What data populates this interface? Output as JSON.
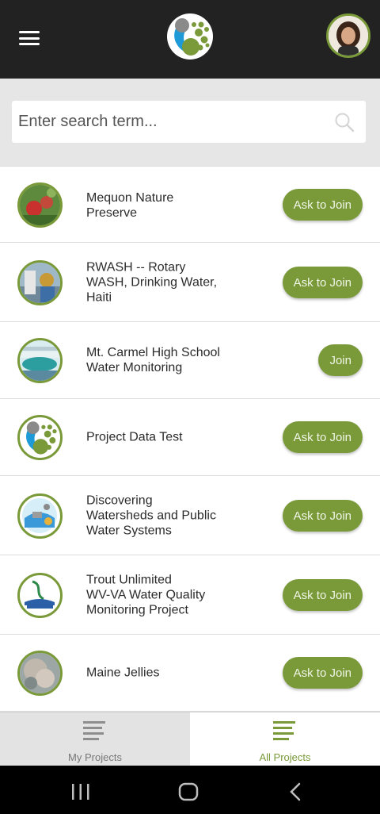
{
  "header": {
    "menu_icon": "hamburger-menu-icon",
    "logo_icon": "app-logo-icon",
    "avatar_icon": "user-avatar",
    "colors": {
      "bar": "#222222",
      "accent": "#7a9a3a"
    }
  },
  "search": {
    "placeholder": "Enter search term...",
    "value": "",
    "icon": "search-icon"
  },
  "projects": [
    {
      "name": "Mequon Nature Preserve",
      "action": "Ask to Join",
      "lines": [
        "Mequon Nature",
        "Preserve"
      ]
    },
    {
      "name": "RWASH -- Rotary WASH, Drinking Water, Haiti",
      "action": "Ask to Join",
      "lines": [
        "RWASH -- Rotary",
        "WASH, Drinking Water,",
        "Haiti"
      ]
    },
    {
      "name": "Mt. Carmel High School Water Monitoring",
      "action": "Join",
      "lines": [
        "Mt. Carmel High School",
        "Water Monitoring"
      ]
    },
    {
      "name": "Project Data Test",
      "action": "Ask to Join",
      "lines": [
        "Project Data Test"
      ]
    },
    {
      "name": "Discovering Watersheds and Public Water Systems",
      "action": "Ask to Join",
      "lines": [
        "Discovering",
        "Watersheds and Public",
        "Water Systems"
      ]
    },
    {
      "name": "Trout Unlimited WV-VA Water Quality Monitoring Project",
      "action": "Ask to Join",
      "lines": [
        "Trout Unlimited",
        "WV-VA Water Quality",
        "Monitoring Project"
      ]
    },
    {
      "name": "Maine Jellies",
      "action": "Ask to Join",
      "lines": [
        "Maine Jellies"
      ]
    }
  ],
  "tabs": {
    "my_projects": {
      "label": "My Projects",
      "icon": "list-icon",
      "active": false
    },
    "all_projects": {
      "label": "All Projects",
      "icon": "list-icon",
      "active": true
    }
  },
  "system_nav": {
    "recents_icon": "recent-apps-icon",
    "home_icon": "home-icon",
    "back_icon": "back-icon"
  }
}
